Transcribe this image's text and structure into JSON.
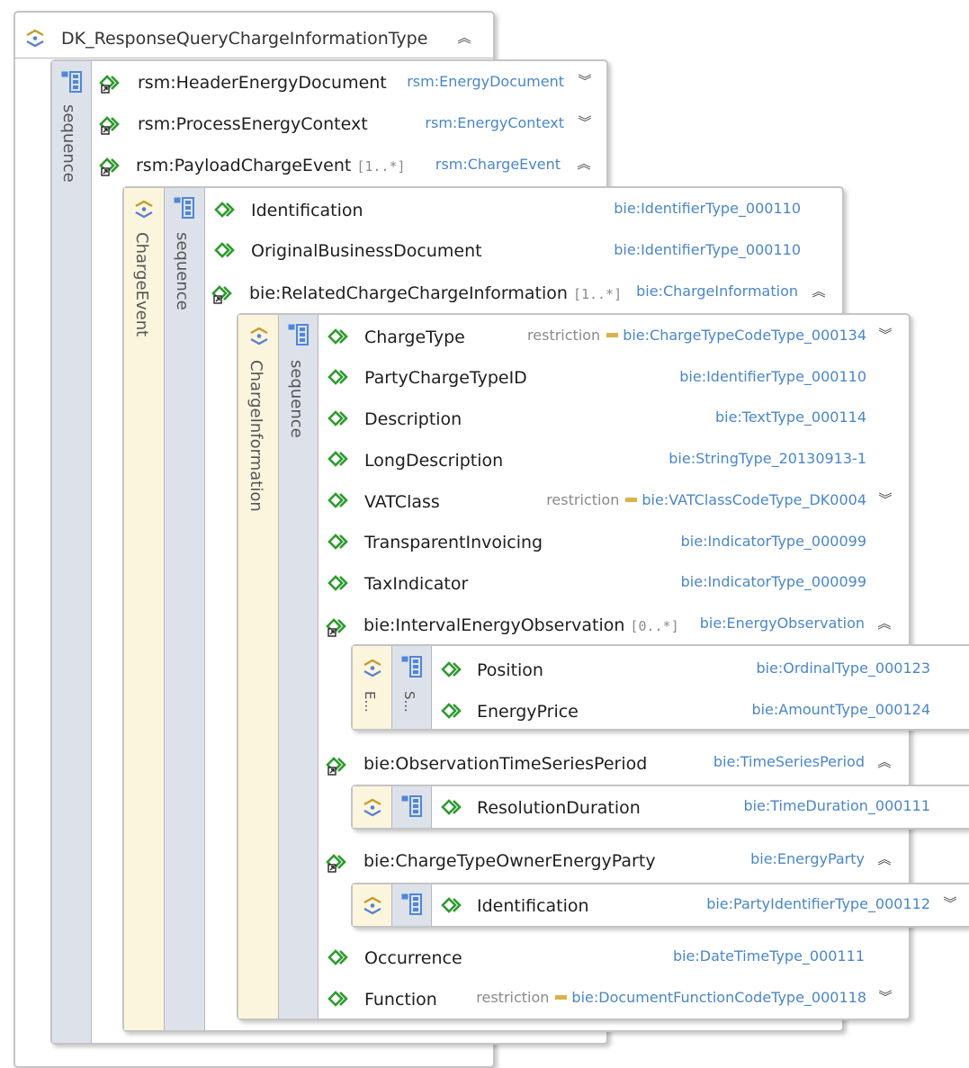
{
  "root": {
    "title": "DK_ResponseQueryChargeInformationType",
    "toggle": "expanded"
  },
  "labels": {
    "sequence": "sequence",
    "charge_event": "ChargeEvent",
    "charge_information": "ChargeInformation",
    "e_short": "E...",
    "s_short": "S..."
  },
  "restriction_label": "restriction",
  "level1": [
    {
      "name": "rsm:HeaderEnergyDocument",
      "type": "rsm:EnergyDocument",
      "toggle": "collapsed"
    },
    {
      "name": "rsm:ProcessEnergyContext",
      "type": "rsm:EnergyContext",
      "toggle": "collapsed"
    },
    {
      "name": "rsm:PayloadChargeEvent",
      "card": "[1..*]",
      "type": "rsm:ChargeEvent",
      "toggle": "expanded"
    }
  ],
  "charge_event": [
    {
      "name": "Identification",
      "type": "bie:IdentifierType_000110"
    },
    {
      "name": "OriginalBusinessDocument",
      "type": "bie:IdentifierType_000110"
    },
    {
      "name": "bie:RelatedChargeChargeInformation",
      "card": "[1..*]",
      "type": "bie:ChargeInformation",
      "toggle": "expanded"
    }
  ],
  "charge_information": [
    {
      "name": "ChargeType",
      "restriction": true,
      "type": "bie:ChargeTypeCodeType_000134",
      "toggle": "collapsed"
    },
    {
      "name": "PartyChargeTypeID",
      "type": "bie:IdentifierType_000110"
    },
    {
      "name": "Description",
      "type": "bie:TextType_000114"
    },
    {
      "name": "LongDescription",
      "type": "bie:StringType_20130913-1"
    },
    {
      "name": "VATClass",
      "restriction": true,
      "type": "bie:VATClassCodeType_DK0004",
      "toggle": "collapsed"
    },
    {
      "name": "TransparentInvoicing",
      "type": "bie:IndicatorType_000099"
    },
    {
      "name": "TaxIndicator",
      "type": "bie:IndicatorType_000099"
    },
    {
      "name": "bie:IntervalEnergyObservation",
      "card": "[0..*]",
      "type": "bie:EnergyObservation",
      "toggle": "expanded"
    },
    {
      "name": "bie:ObservationTimeSeriesPeriod",
      "type": "bie:TimeSeriesPeriod",
      "toggle": "expanded"
    },
    {
      "name": "bie:ChargeTypeOwnerEnergyParty",
      "type": "bie:EnergyParty",
      "toggle": "expanded"
    },
    {
      "name": "Occurrence",
      "type": "bie:DateTimeType_000111"
    },
    {
      "name": "Function",
      "restriction": true,
      "type": "bie:DocumentFunctionCodeType_000118",
      "toggle": "collapsed"
    }
  ],
  "energy_observation": [
    {
      "name": "Position",
      "type": "bie:OrdinalType_000123"
    },
    {
      "name": "EnergyPrice",
      "type": "bie:AmountType_000124"
    }
  ],
  "time_series_period": [
    {
      "name": "ResolutionDuration",
      "type": "bie:TimeDuration_000111"
    }
  ],
  "energy_party": [
    {
      "name": "Identification",
      "type": "bie:PartyIdentifierType_000112",
      "toggle": "collapsed"
    }
  ],
  "colors": {
    "type_link": "#4a86c8",
    "element_icon": "#2e9a2e",
    "cream": "#fcf5dd",
    "sequence": "#dde1ea"
  }
}
